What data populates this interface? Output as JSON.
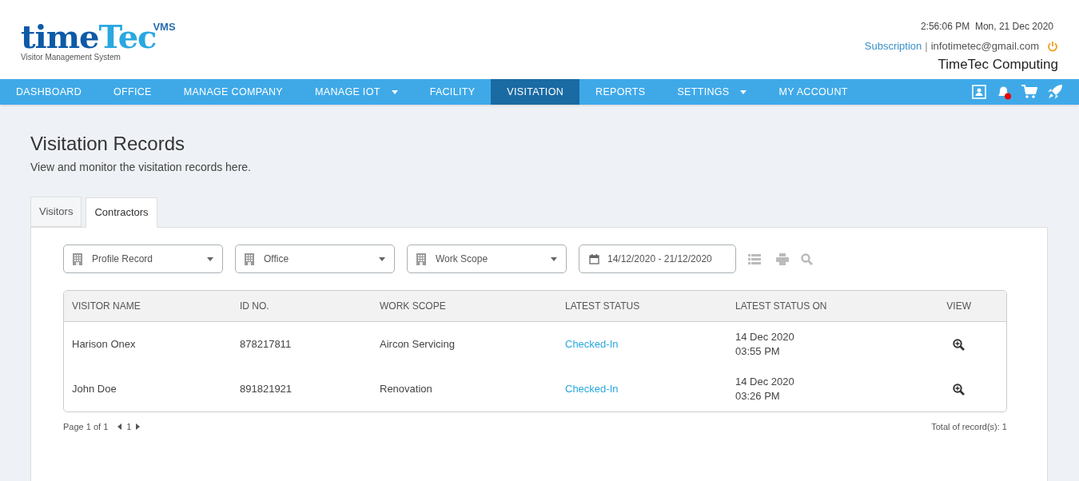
{
  "logo": {
    "word_a": "time",
    "word_b": "Tec",
    "badge": "VMS",
    "subtitle": "Visitor Management System"
  },
  "header": {
    "clock": "2:56:06 PM  Mon, 21 Dec 2020",
    "subscription": "Subscription",
    "separator": "|",
    "email": "infotimetec@gmail.com",
    "company": "TimeTec Computing"
  },
  "nav": [
    {
      "label": "DASHBOARD",
      "selected": false,
      "dropdown": false
    },
    {
      "label": "OFFICE",
      "selected": false,
      "dropdown": false
    },
    {
      "label": "MANAGE COMPANY",
      "selected": false,
      "dropdown": false
    },
    {
      "label": "MANAGE IOT",
      "selected": false,
      "dropdown": true
    },
    {
      "label": "FACILITY",
      "selected": false,
      "dropdown": false
    },
    {
      "label": "VISITATION",
      "selected": true,
      "dropdown": false
    },
    {
      "label": "REPORTS",
      "selected": false,
      "dropdown": false
    },
    {
      "label": "SETTINGS",
      "selected": false,
      "dropdown": true
    },
    {
      "label": "MY ACCOUNT",
      "selected": false,
      "dropdown": false
    }
  ],
  "page": {
    "title": "Visitation Records",
    "subtitle": "View and monitor the visitation records here."
  },
  "tabs": [
    {
      "label": "Visitors",
      "selected": false
    },
    {
      "label": "Contractors",
      "selected": true
    }
  ],
  "filters": [
    {
      "kind": "select",
      "value": "Profile Record"
    },
    {
      "kind": "select",
      "value": "Office"
    },
    {
      "kind": "select",
      "value": "Work Scope"
    },
    {
      "kind": "date",
      "value": "14/12/2020 - 21/12/2020"
    }
  ],
  "table": {
    "columns": [
      "VISITOR NAME",
      "ID NO.",
      "WORK SCOPE",
      "LATEST STATUS",
      "LATEST STATUS ON",
      "VIEW"
    ],
    "rows": [
      {
        "name": "Harison Onex",
        "id": "878217811",
        "scope": "Aircon Servicing",
        "status": "Checked-In",
        "date": "14 Dec 2020",
        "time": "03:55 PM"
      },
      {
        "name": "John Doe",
        "id": "891821921",
        "scope": "Renovation",
        "status": "Checked-In",
        "date": "14 Dec 2020",
        "time": "03:26 PM"
      }
    ]
  },
  "pagination": {
    "info": "Page 1 of 1",
    "page": "1",
    "total": "Total of record(s): 1"
  }
}
